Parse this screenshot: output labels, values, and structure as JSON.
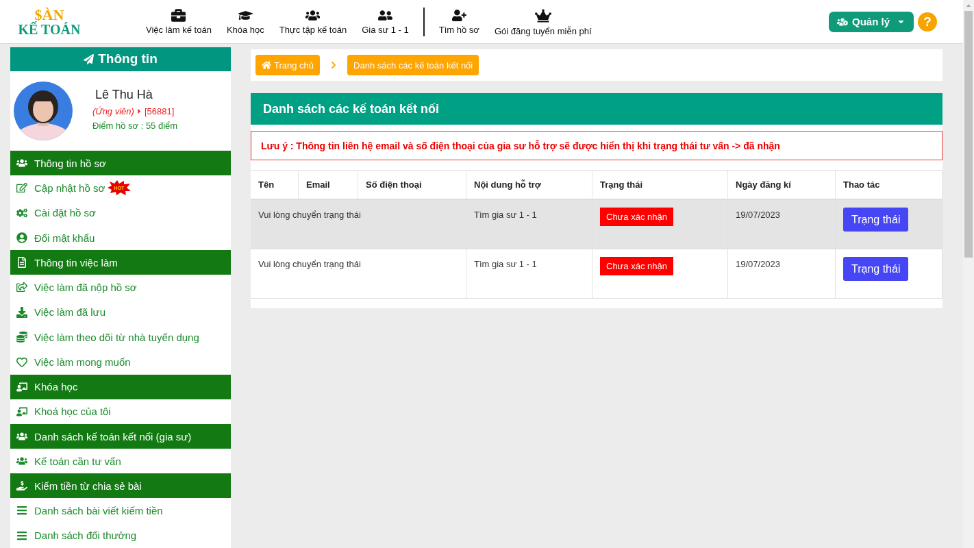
{
  "logo": {
    "line_1": "$ÀN",
    "line_2": "KẾ TOÁN"
  },
  "nav": [
    [
      {
        "label": "Việc làm kế toán"
      },
      {
        "label": "Khóa học"
      },
      {
        "label": "Thực tập kế toán"
      },
      {
        "label": "Gia sư 1 - 1"
      }
    ],
    [
      {
        "label": "Tìm hồ sơ"
      },
      {
        "label": "Gói đăng tuyển miễn phí"
      }
    ]
  ],
  "manage_button": {
    "label": "Quản lý"
  },
  "help_button": {
    "label": "?"
  },
  "sidebar": {
    "title": "Thông tin",
    "profile": {
      "name": "Lê Thu Hà",
      "role": "(Ứng viên)",
      "id": "[56881]",
      "score": "Điểm hồ sơ : 55 điểm"
    },
    "items": [
      {
        "kind": "header",
        "label": "Thông tin hồ sơ"
      },
      {
        "kind": "link",
        "label": "Cập nhật hồ sơ",
        "badge": "HOT"
      },
      {
        "kind": "link",
        "label": "Cài đặt hồ sơ"
      },
      {
        "kind": "link",
        "label": "Đổi mật khẩu"
      },
      {
        "kind": "header",
        "label": "Thông tin việc làm"
      },
      {
        "kind": "link",
        "label": "Việc làm đã nộp hồ sơ"
      },
      {
        "kind": "link",
        "label": "Việc làm đã lưu"
      },
      {
        "kind": "link",
        "label": "Việc làm theo dõi từ nhà tuyển dụng"
      },
      {
        "kind": "link",
        "label": "Việc làm mong muốn"
      },
      {
        "kind": "header",
        "label": "Khóa học"
      },
      {
        "kind": "link",
        "label": "Khoá học của tôi"
      },
      {
        "kind": "header",
        "label": "Danh sách kế toán kết nối (gia sư)"
      },
      {
        "kind": "link",
        "label": "Kế toán cần tư vấn"
      },
      {
        "kind": "header",
        "label": "Kiếm tiền từ chia sẻ bài"
      },
      {
        "kind": "link",
        "label": "Danh sách bài viết kiếm tiền"
      },
      {
        "kind": "link",
        "label": "Danh sách đổi thưởng"
      }
    ]
  },
  "breadcrumb": [
    {
      "label": "Trang chủ"
    },
    {
      "label": "Danh sách các kế toán kết nối"
    }
  ],
  "panel": {
    "title": "Danh sách các kế toán kết nối",
    "notice": "Lưu ý : Thông tin liên hệ email và số điện thoại của gia sư hỗ trợ sẽ được hiển thị khi trạng thái tư vấn -> đã nhận"
  },
  "table": {
    "columns": [
      "Tên",
      "Email",
      "Số điện thoại",
      "Nội dung hỗ trợ",
      "Trạng thái",
      "Ngày đăng kí",
      "Thao tác"
    ],
    "rows": [
      {
        "name": "Vui lòng chuyển trạng thái",
        "support": "Tìm gia sư 1 - 1",
        "status": "Chưa xác nhận",
        "date": "19/07/2023",
        "action": "Trạng thái",
        "selected": true
      },
      {
        "name": "Vui lòng chuyển trạng thái",
        "support": "Tìm gia sư 1 - 1",
        "status": "Chưa xác nhận",
        "date": "19/07/2023",
        "action": "Trạng thái",
        "selected": false
      }
    ]
  }
}
